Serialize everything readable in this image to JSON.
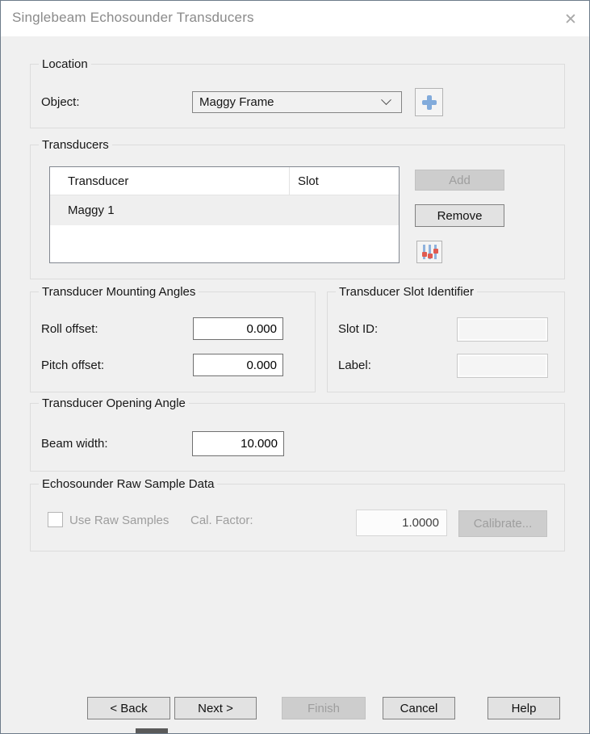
{
  "window": {
    "title": "Singlebeam Echosounder Transducers",
    "close_glyph": "✕"
  },
  "location": {
    "group_title": "Location",
    "object_label": "Object:",
    "object_value": "Maggy Frame"
  },
  "transducers": {
    "group_title": "Transducers",
    "columns": {
      "transducer": "Transducer",
      "slot": "Slot"
    },
    "rows": [
      {
        "transducer": "Maggy 1",
        "slot": ""
      }
    ],
    "add_label": "Add",
    "remove_label": "Remove"
  },
  "mounting_angles": {
    "group_title": "Transducer Mounting Angles",
    "roll_label": "Roll offset:",
    "roll_value": "0.000",
    "pitch_label": "Pitch offset:",
    "pitch_value": "0.000"
  },
  "slot_identifier": {
    "group_title": "Transducer Slot Identifier",
    "slot_id_label": "Slot ID:",
    "slot_id_value": "",
    "label_label": "Label:",
    "label_value": ""
  },
  "opening_angle": {
    "group_title": "Transducer Opening Angle",
    "beam_width_label": "Beam width:",
    "beam_width_value": "10.000"
  },
  "raw_sample": {
    "group_title": "Echosounder Raw Sample Data",
    "use_raw_samples_label": "Use Raw Samples",
    "cal_factor_label": "Cal. Factor:",
    "cal_factor_value": "1.0000",
    "calibrate_label": "Calibrate..."
  },
  "footer": {
    "back_label": "< Back",
    "next_label": "Next >",
    "finish_label": "Finish",
    "cancel_label": "Cancel",
    "help_label": "Help"
  },
  "colors": {
    "dialog_bg": "#f0f0f0",
    "titlebar_bg": "#ffffff",
    "title_text": "#8a8a8a",
    "group_border": "#dcdcdc",
    "selected_row_bg": "#efefef",
    "plus_icon_blue": "#82abdb",
    "slider_bar_blue": "#8fb2dd",
    "slider_dot_red": "#e05a50",
    "disabled_btn_bg": "#cdcdcd",
    "enabled_btn_bg": "#e2e2e2"
  }
}
